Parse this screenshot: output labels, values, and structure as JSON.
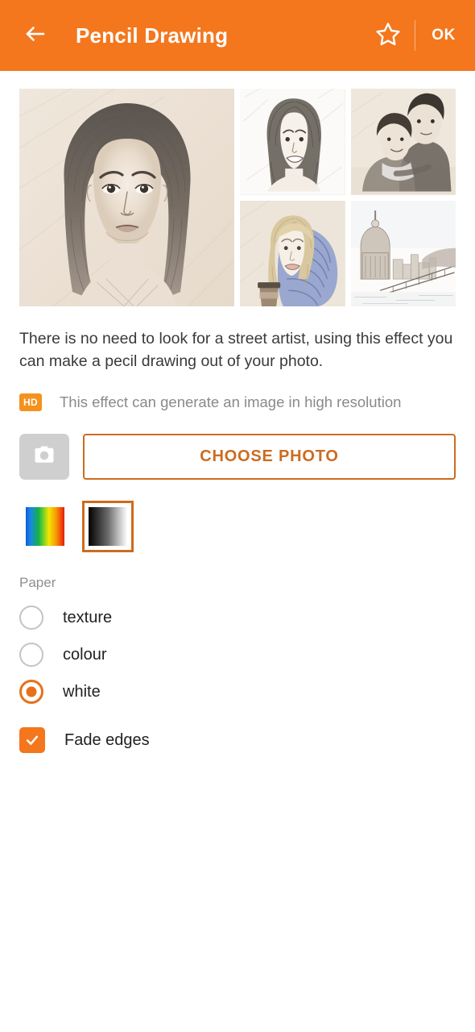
{
  "appbar": {
    "back_icon": "arrow-left-icon",
    "title": "Pencil Drawing",
    "star_icon": "star-outline-icon",
    "ok_label": "OK"
  },
  "gallery": {
    "main": {
      "alt": "pencil sketch portrait of a dark haired woman on sepia paper"
    },
    "thumbs": [
      {
        "alt": "pencil sketch of a smiling young woman"
      },
      {
        "alt": "pencil sketch of a couple embracing"
      },
      {
        "alt": "pencil sketch of a blonde woman in a blue knit scarf holding a coffee cup"
      },
      {
        "alt": "pencil sketch of a city skyline with cathedral and bridge"
      }
    ]
  },
  "description": "There is no need to look for a street artist, using this effect you can make a pecil drawing out of your photo.",
  "hd": {
    "badge": "HD",
    "text": "This effect can generate an image in high resolution"
  },
  "actions": {
    "camera_icon": "camera-icon",
    "choose_photo_label": "CHOOSE PHOTO"
  },
  "swatches": [
    {
      "name": "colour-gradient",
      "selected": false
    },
    {
      "name": "greyscale-gradient",
      "selected": true
    }
  ],
  "paper": {
    "label": "Paper",
    "options": [
      {
        "label": "texture",
        "selected": false
      },
      {
        "label": "colour",
        "selected": false
      },
      {
        "label": "white",
        "selected": true
      }
    ]
  },
  "fade_edges": {
    "label": "Fade edges",
    "checked": true
  },
  "colors": {
    "accent": "#F4771E",
    "accent_border": "#CC6C20",
    "radio_selected": "#E8701A",
    "hd_badge": "#F4921E",
    "camera_button": "#CFCFCF",
    "text_primary": "#222222",
    "text_muted": "#8A8A8A"
  }
}
